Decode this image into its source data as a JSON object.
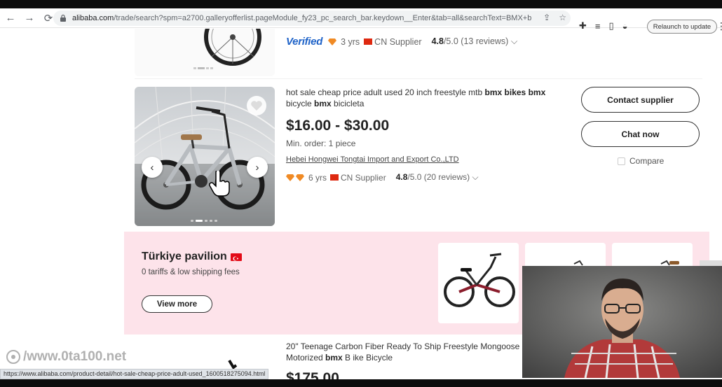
{
  "browser": {
    "url_domain": "alibaba.com",
    "url_path": "/trade/search?spm=a2700.galleryofferlist.pageModule_fy23_pc_search_bar.keydown__Enter&tab=all&searchText=BMX+bike+",
    "relaunch_label": "Relaunch to update"
  },
  "prev_listing": {
    "verified_label": "Verified",
    "years": "3 yrs",
    "supplier": "CN Supplier",
    "rating": "4.8",
    "rating_suffix": "/5.0 (13 reviews)"
  },
  "listing": {
    "title_parts": [
      "hot sale cheap price adult used 20 inch freestyle mtb ",
      "bmx",
      " ",
      "bikes",
      " ",
      "bmx",
      " bicycle ",
      "bmx",
      " bicicleta"
    ],
    "price": "$16.00 - $30.00",
    "min_order": "Min. order: 1 piece",
    "company": "Hebei Hongwei Tongtai Import and Export Co.,LTD",
    "years": "6 yrs",
    "supplier": "CN Supplier",
    "rating": "4.8",
    "rating_suffix": "/5.0 (20 reviews)",
    "contact_label": "Contact supplier",
    "chat_label": "Chat now",
    "compare_label": "Compare"
  },
  "pavilion": {
    "title": "Türkiye pavilion",
    "subtitle": "0 tariffs & low shipping fees",
    "view_more": "View more"
  },
  "next_listing": {
    "title_line1": "20\" Teenage Carbon Fiber Ready To Ship Freestyle Mongoose E",
    "title_line2_pre": "Motorized ",
    "title_line2_bold": "bmx",
    "title_line2_post": " B ike Bicycle",
    "price": "$175.00"
  },
  "status_url": "https://www.alibaba.com/product-detail/hot-sale-cheap-price-adult-used_1600518275094.html",
  "watermark": "/www.0ta100.net",
  "colors": {
    "accent_blue": "#1f63c8",
    "pavilion_bg": "#fde3ea",
    "flag_red": "#de2910"
  }
}
